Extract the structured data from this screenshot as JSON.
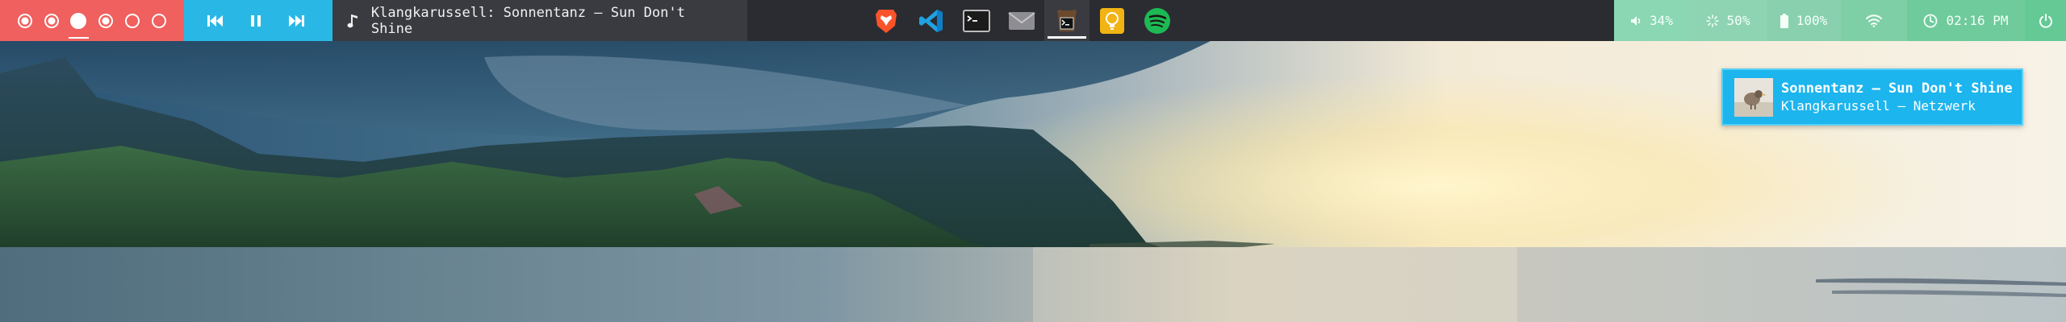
{
  "panel": {
    "workspaces": [
      {
        "name": "1",
        "state": "occupied"
      },
      {
        "name": "2",
        "state": "occupied"
      },
      {
        "name": "3",
        "state": "active"
      },
      {
        "name": "4",
        "state": "occupied"
      },
      {
        "name": "5",
        "state": "empty"
      },
      {
        "name": "6",
        "state": "empty"
      }
    ],
    "media": {
      "now_playing": "Klangkarussell: Sonnentanz – Sun Don't Shine"
    },
    "taskbar": [
      {
        "app": "Brave",
        "icon": "brave-lion-icon"
      },
      {
        "app": "Visual Studio Code",
        "icon": "vscode-icon"
      },
      {
        "app": "Terminal",
        "icon": "terminal-icon"
      },
      {
        "app": "Mail",
        "icon": "mail-envelope-icon"
      },
      {
        "app": "Terminal (Tux)",
        "icon": "tux-terminal-icon",
        "focused": true
      },
      {
        "app": "Lightbulb",
        "icon": "lightbulb-icon"
      },
      {
        "app": "Spotify",
        "icon": "spotify-icon"
      }
    ],
    "status": {
      "volume": "34%",
      "brightness": "50%",
      "battery": "100%",
      "clock": "02:16 PM"
    }
  },
  "notification": {
    "title": "Sonnentanz – Sun Don't Shine",
    "body": "Klangkarussell – Netzwerk"
  },
  "colors": {
    "workspaces_bg": "#f0605e",
    "media_bg": "#29b8e6",
    "status_bg": "#7fcfa6",
    "notification_bg": "#1db5ee"
  }
}
